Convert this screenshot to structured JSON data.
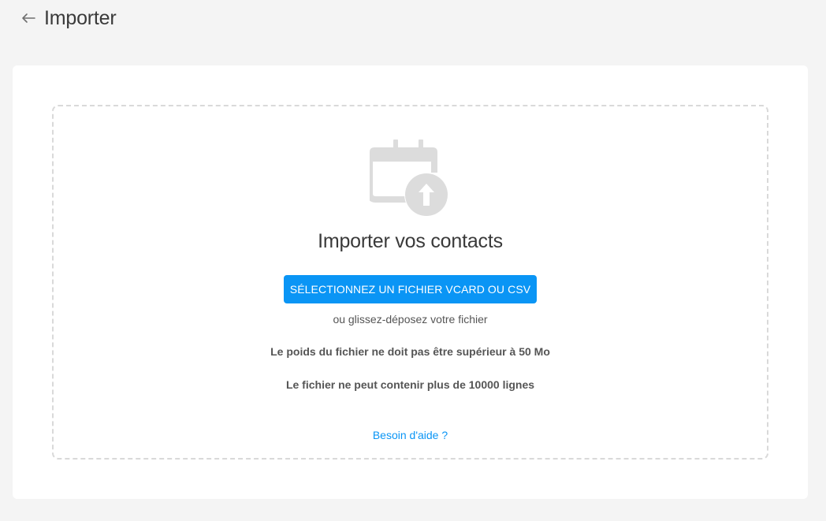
{
  "header": {
    "back_icon": "arrow-left-icon",
    "title": "Importer"
  },
  "dropzone": {
    "icon": "calendar-upload-icon",
    "title": "Importer vos contacts",
    "select_button_label": "SÉLECTIONNEZ UN FICHIER VCARD OU CSV",
    "drag_text": "ou glissez-déposez votre fichier",
    "rules": [
      "Le poids du fichier ne doit pas être supérieur à 50 Mo",
      "Le fichier ne peut contenir plus de 10000 lignes"
    ],
    "help_link": "Besoin d'aide ?"
  },
  "colors": {
    "accent": "#0a95f5",
    "background": "#f4f4f4",
    "card": "#ffffff",
    "icon_gray": "#dcdcdc"
  }
}
